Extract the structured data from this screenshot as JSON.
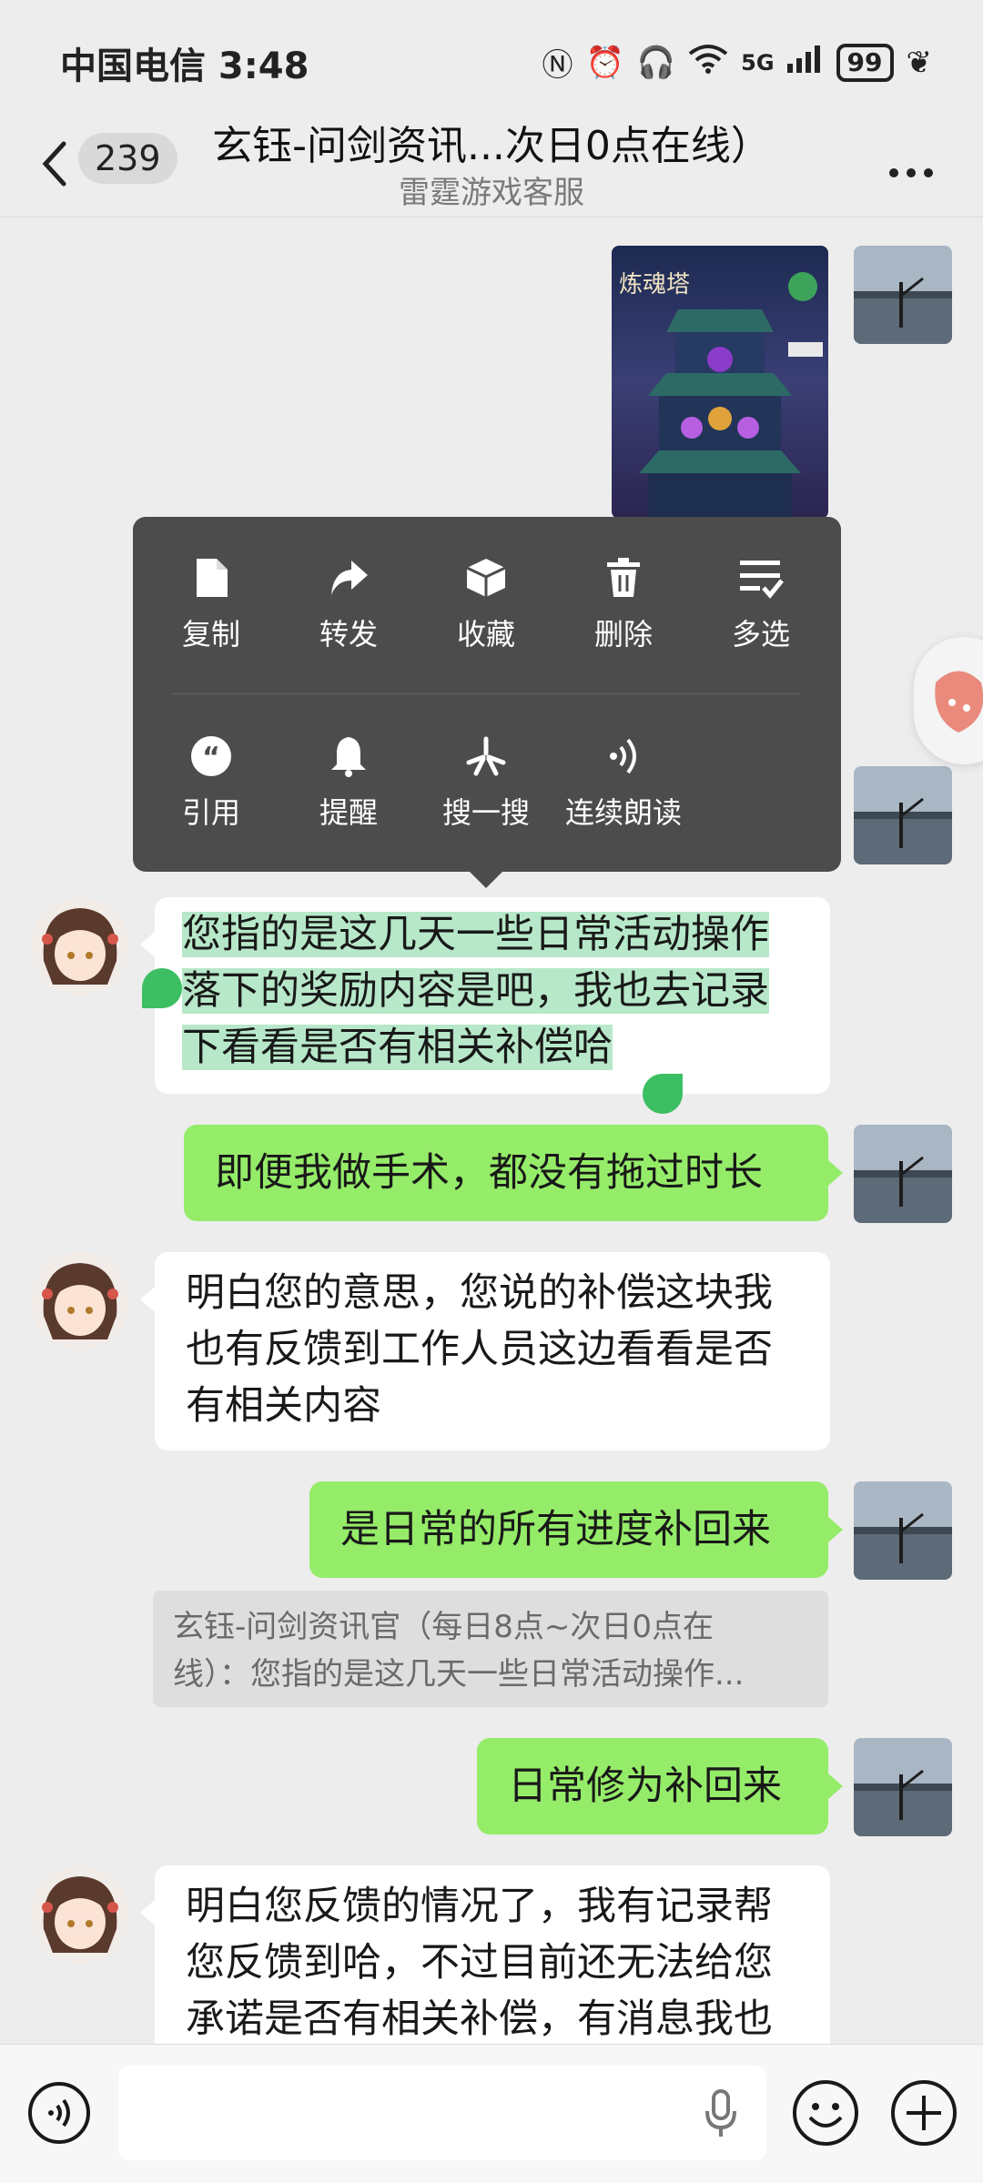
{
  "status_bar": {
    "carrier_time": "中国电信 3:48",
    "network": "5G",
    "battery": "99"
  },
  "header": {
    "unread_count": "239",
    "title": "玄钰-问剑资讯...次日0点在线）",
    "subtitle": "雷霆游戏客服"
  },
  "context_menu": {
    "row1": [
      {
        "label": "复制",
        "icon": "copy-icon"
      },
      {
        "label": "转发",
        "icon": "forward-icon"
      },
      {
        "label": "收藏",
        "icon": "favorite-icon"
      },
      {
        "label": "删除",
        "icon": "delete-icon"
      },
      {
        "label": "多选",
        "icon": "multiselect-icon"
      }
    ],
    "row2": [
      {
        "label": "引用",
        "icon": "quote-icon"
      },
      {
        "label": "提醒",
        "icon": "bell-icon"
      },
      {
        "label": "搜一搜",
        "icon": "search-star-icon"
      },
      {
        "label": "连续朗读",
        "icon": "read-aloud-icon"
      }
    ]
  },
  "shared_image": {
    "title_text": "炼魂塔"
  },
  "messages": [
    {
      "from": "agent",
      "text_lines": [
        "您指的是这几天一些日常活动操作",
        "落下的奖励内容是吧，我也去记录",
        "下看看是否有相关补偿哈"
      ],
      "selected": true
    },
    {
      "from": "me",
      "text": "即便我做手术，都没有拖过时长"
    },
    {
      "from": "agent",
      "text_lines": [
        "明白您的意思，您说的补偿这块我",
        "也有反馈到工作人员这边看看是否",
        "有相关内容"
      ]
    },
    {
      "from": "me",
      "text": "是日常的所有进度补回来"
    },
    {
      "from": "me",
      "text": "日常修为补回来",
      "quote_lines": [
        "玄钰-问剑资讯官（每日8点~次日0点在",
        "线）：您指的是这几天一些日常活动操作..."
      ]
    },
    {
      "from": "agent",
      "text_lines": [
        "明白您反馈的情况了，我有记录帮",
        "您反馈到哈，不过目前还无法给您",
        "承诺是否有相关补偿，有消息我也"
      ]
    }
  ],
  "colors": {
    "outgoing_bubble": "#95ec69",
    "incoming_bubble": "#ffffff",
    "menu_bg": "#4c4c4c",
    "selection": "#b7e8c9",
    "handle": "#3cbf63"
  }
}
